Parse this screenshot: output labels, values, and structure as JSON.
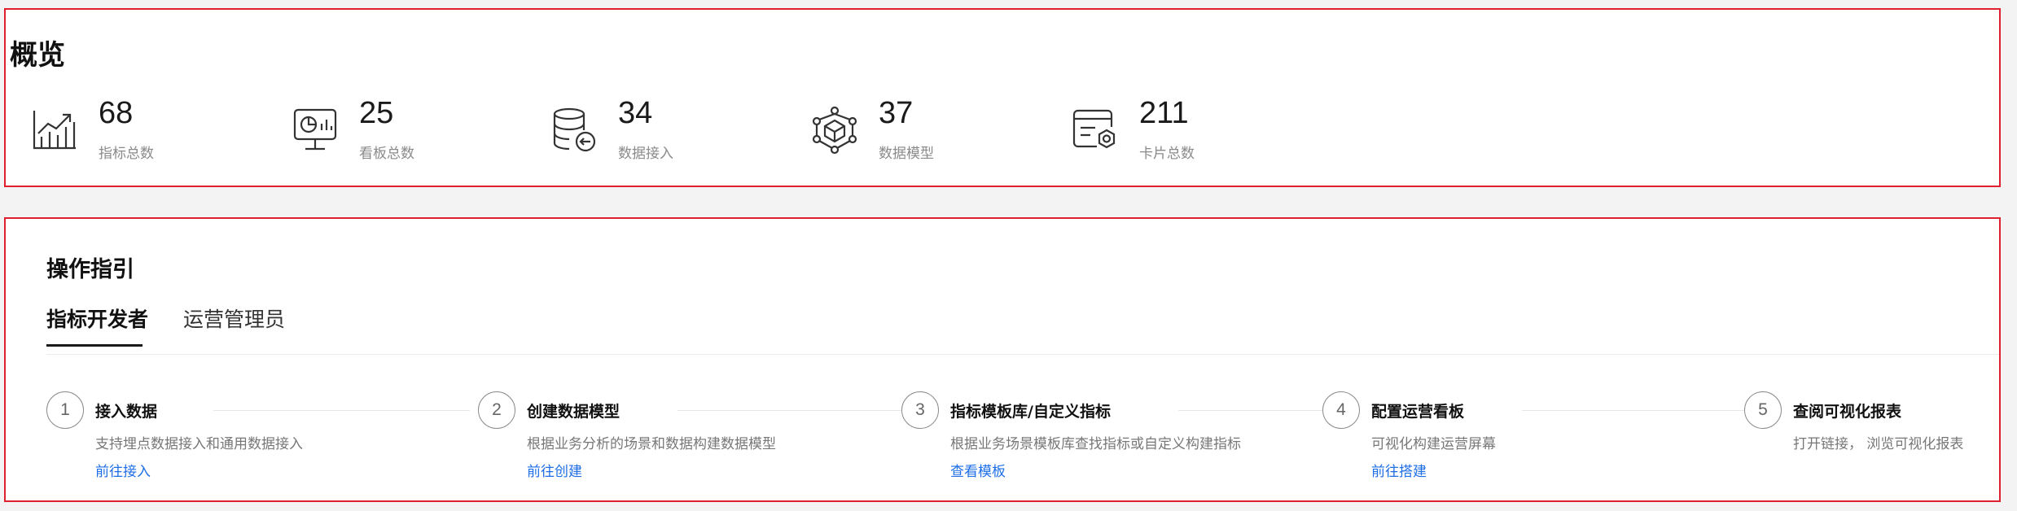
{
  "overview": {
    "title": "概览",
    "stats": [
      {
        "value": "68",
        "label": "指标总数",
        "icon": "line-chart-icon"
      },
      {
        "value": "25",
        "label": "看板总数",
        "icon": "dashboard-monitor-icon"
      },
      {
        "value": "34",
        "label": "数据接入",
        "icon": "database-import-icon"
      },
      {
        "value": "37",
        "label": "数据模型",
        "icon": "network-model-icon"
      },
      {
        "value": "211",
        "label": "卡片总数",
        "icon": "card-settings-icon"
      }
    ]
  },
  "guide": {
    "title": "操作指引",
    "tabs": [
      {
        "label": "指标开发者",
        "active": true
      },
      {
        "label": "运营管理员",
        "active": false
      }
    ],
    "steps": [
      {
        "num": "1",
        "title": "接入数据",
        "desc": "支持埋点数据接入和通用数据接入",
        "link": "前往接入"
      },
      {
        "num": "2",
        "title": "创建数据模型",
        "desc": "根据业务分析的场景和数据构建数据模型",
        "link": "前往创建"
      },
      {
        "num": "3",
        "title": "指标模板库/自定义指标",
        "desc": "根据业务场景模板库查找指标或自定义构建指标",
        "link": "查看模板"
      },
      {
        "num": "4",
        "title": "配置运营看板",
        "desc": "可视化构建运营屏幕",
        "link": "前往搭建"
      },
      {
        "num": "5",
        "title": "查阅可视化报表",
        "desc": "打开链接， 浏览可视化报表",
        "link": ""
      }
    ]
  },
  "colors": {
    "highlight_border": "#e0202e",
    "link": "#1e6ee6",
    "page_background": "#f3f3f4"
  }
}
